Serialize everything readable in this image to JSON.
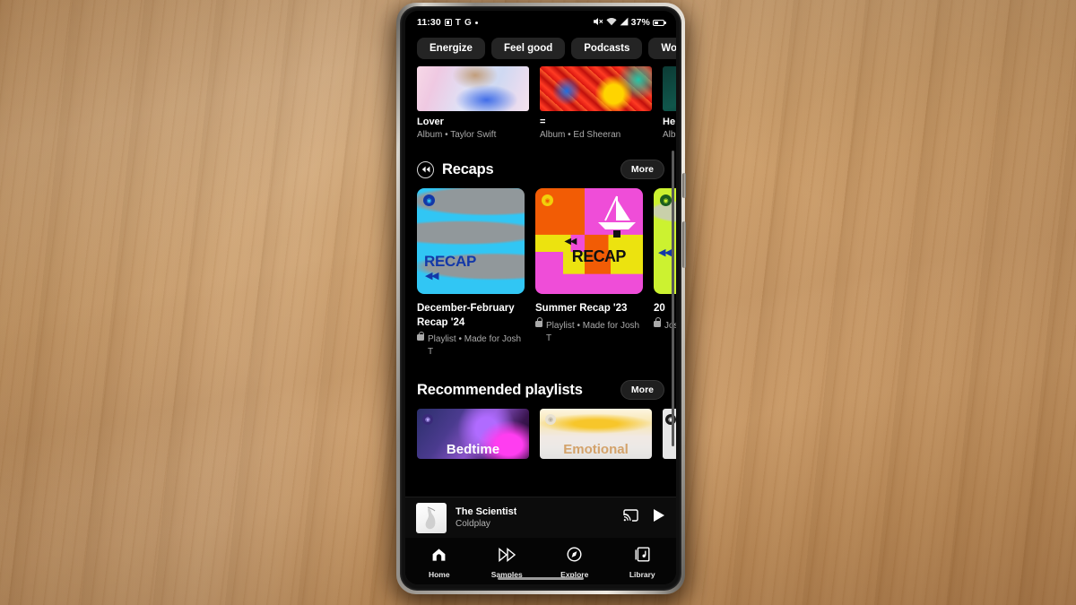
{
  "device": {
    "name": "android-phone",
    "frame_color": "#b9b5ae",
    "screen_bg": "#000000"
  },
  "status_bar": {
    "time": "11:30",
    "left_icons": [
      "screenshot-icon",
      "vpn-icon",
      "google-icon",
      "dot-icon"
    ],
    "vpn_glyph": "T",
    "google_glyph": "G",
    "right_icons": [
      "mute-icon",
      "wifi-icon",
      "signal-icon"
    ],
    "battery_percent": "37%"
  },
  "chips": [
    {
      "label": "Energize"
    },
    {
      "label": "Feel good"
    },
    {
      "label": "Podcasts"
    },
    {
      "label": "Wor"
    }
  ],
  "albums_row": [
    {
      "title": "Lover",
      "subtitle": "Album • Taylor Swift",
      "art": "lover-cover"
    },
    {
      "title": "=",
      "subtitle": "Album • Ed Sheeran",
      "art": "equals-cover"
    },
    {
      "title": "He",
      "subtitle": "Alb",
      "art": "partial-cover"
    }
  ],
  "recaps": {
    "header": {
      "icon": "rewind-icon",
      "title": "Recaps",
      "more_label": "More"
    },
    "items": [
      {
        "title": "December-February Recap '24",
        "meta": "Playlist • Made for Josh T",
        "art_label": "RECAP",
        "art_arrow": "◀◀",
        "art_color": "#31c6f4"
      },
      {
        "title": "Summer Recap '23",
        "meta": "Playlist • Made for Josh T",
        "art_label": "RECAP",
        "art_arrow": "◀◀",
        "art_color": "#ef4dd8"
      },
      {
        "title": "20",
        "meta": "Jos",
        "art_label": "",
        "art_arrow": "◀◀",
        "art_color": "#ccf230"
      }
    ]
  },
  "recommended": {
    "header": {
      "title": "Recommended playlists",
      "more_label": "More"
    },
    "items": [
      {
        "label": "Bedtime",
        "badge": "playlist-badge-icon"
      },
      {
        "label": "Emotional",
        "badge": "playlist-badge-icon"
      },
      {
        "label": "",
        "badge": "playlist-badge-icon"
      }
    ]
  },
  "now_playing": {
    "title": "The Scientist",
    "artist": "Coldplay",
    "cast_icon": "cast-icon",
    "play_icon": "play-icon"
  },
  "bottom_nav": [
    {
      "label": "Home",
      "icon": "home-icon",
      "active": true
    },
    {
      "label": "Samples",
      "icon": "samples-icon",
      "active": false
    },
    {
      "label": "Explore",
      "icon": "compass-icon",
      "active": false
    },
    {
      "label": "Library",
      "icon": "library-icon",
      "active": false
    }
  ]
}
